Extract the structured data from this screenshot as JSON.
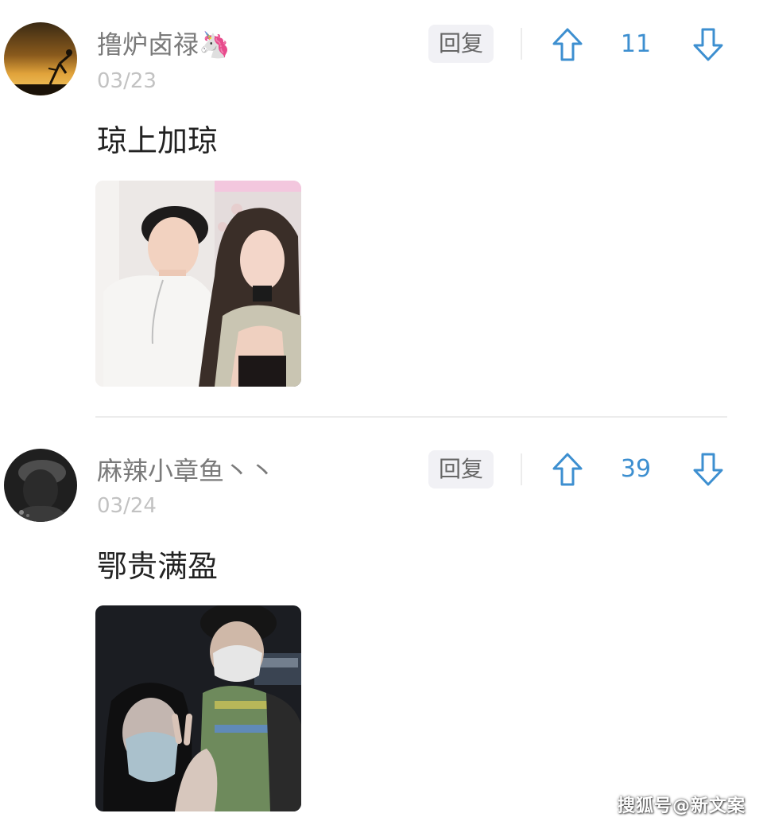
{
  "comments": [
    {
      "username": "撸炉卤禄🦄",
      "date": "03/23",
      "reply_label": "回复",
      "vote_count": "11",
      "text": "琼上加琼",
      "avatar_icon": "sunset-silhouette-avatar",
      "photo_desc": "couple-selfie-indoor"
    },
    {
      "username": "麻辣小章鱼丶丶",
      "date": "03/24",
      "reply_label": "回复",
      "vote_count": "39",
      "text": "鄂贵满盈",
      "avatar_icon": "dark-portrait-avatar",
      "photo_desc": "couple-selfie-night"
    }
  ],
  "colors": {
    "accent_blue": "#3d8fd0",
    "username_gray": "#7a7a7a",
    "date_gray": "#c2c2c2"
  },
  "watermark": "搜狐号@新文案"
}
